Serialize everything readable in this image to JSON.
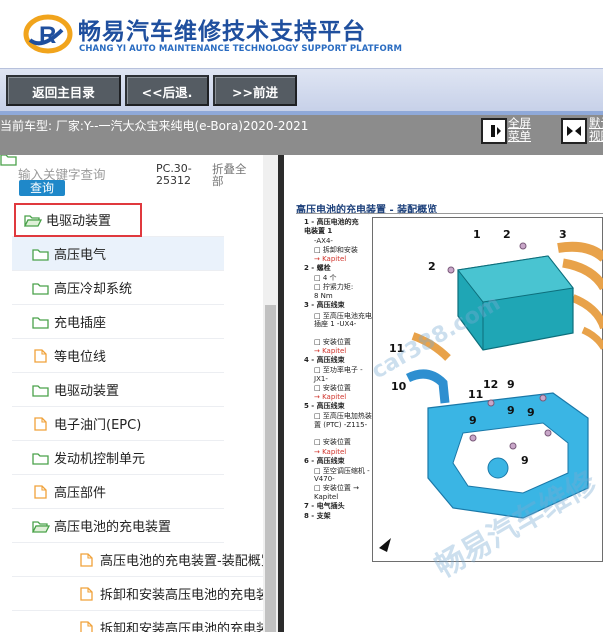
{
  "header": {
    "title_cn": "畅易汽车维修技术支持平台",
    "title_en": "CHANG YI AUTO MAINTENANCE TECHNOLOGY SUPPORT PLATFORM"
  },
  "nav": {
    "home": "返回主目录",
    "back": "<<后退.",
    "forward": ">>前进"
  },
  "carbar": {
    "current_car": "当前车型:  厂家:Y--一汽大众宝来纯电(e-Bora)2020-2021",
    "fullscreen_1": "全屏",
    "fullscreen_2": "菜单",
    "default_1": "默认",
    "default_2": "视图"
  },
  "left": {
    "search_placeholder": "输入关键字查询",
    "query_btn": "查询",
    "pc_label_1": "PC.30-",
    "pc_label_2": "25312",
    "collapse_1": "折叠全",
    "collapse_2": "部",
    "tree": [
      {
        "label": "电驱动装置",
        "icon": "folder-open-icon",
        "level": 1
      },
      {
        "label": "高压电气",
        "icon": "folder-icon",
        "level": 2
      },
      {
        "label": "高压冷却系统",
        "icon": "folder-icon",
        "level": 2
      },
      {
        "label": "充电插座",
        "icon": "folder-icon",
        "level": 2
      },
      {
        "label": "等电位线",
        "icon": "document-icon",
        "level": 2
      },
      {
        "label": "电驱动装置",
        "icon": "folder-icon",
        "level": 2
      },
      {
        "label": "电子油门(EPC)",
        "icon": "document-icon",
        "level": 2
      },
      {
        "label": "发动机控制单元",
        "icon": "folder-icon",
        "level": 2
      },
      {
        "label": "高压部件",
        "icon": "document-icon",
        "level": 2
      },
      {
        "label": "高压电池的充电装置",
        "icon": "folder-open-icon",
        "level": 2
      },
      {
        "label": "高压电池的充电装置-装配概览",
        "icon": "document-icon",
        "level": 3
      },
      {
        "label": "拆卸和安装高压电池的充电装置",
        "icon": "document-icon",
        "level": 3
      },
      {
        "label": "拆卸和安装高压电池的充电装置",
        "icon": "document-icon",
        "level": 3
      }
    ]
  },
  "doc": {
    "title": "高压电池的充电装置 - 装配概览",
    "watermark_1": "car388.com",
    "watermark_2": "畅易汽车维修",
    "legend": [
      {
        "n": "1 -",
        "t": "高压电池的充电装置 1",
        "b": true
      },
      {
        "n": "",
        "t": "-AX4-",
        "b": false
      },
      {
        "n": "",
        "t": "□ 拆卸和安装",
        "b": false
      },
      {
        "n": "",
        "t": "→ Kapitel",
        "r": true
      },
      {
        "n": "2 -",
        "t": "螺栓",
        "b": true
      },
      {
        "n": "",
        "t": "□ 4 个",
        "b": false
      },
      {
        "n": "",
        "t": "□ 拧紧力矩:",
        "b": false
      },
      {
        "n": "",
        "t": "8 Nm",
        "b": false
      },
      {
        "n": "3 -",
        "t": "高压线束",
        "b": true
      },
      {
        "n": "",
        "t": "□ 至高压电池充电插座 1 -UX4-",
        "b": false
      },
      {
        "n": "",
        "t": "□ 安装位置",
        "b": false
      },
      {
        "n": "",
        "t": "→ Kapitel",
        "r": true
      },
      {
        "n": "4 -",
        "t": "高压线束",
        "b": true
      },
      {
        "n": "",
        "t": "□ 至功率电子 -JX1-",
        "b": false
      },
      {
        "n": "",
        "t": "□ 安装位置",
        "b": false
      },
      {
        "n": "",
        "t": "→ Kapitel",
        "r": true
      },
      {
        "n": "5 -",
        "t": "高压线束",
        "b": true
      },
      {
        "n": "",
        "t": "□ 至高压电加热装置 (PTC) -Z115-",
        "b": false
      },
      {
        "n": "",
        "t": "□ 安装位置",
        "b": false
      },
      {
        "n": "",
        "t": "→ Kapitel",
        "r": true
      },
      {
        "n": "6 -",
        "t": "高压线束",
        "b": true
      },
      {
        "n": "",
        "t": "□ 至空调压缩机 -V470-",
        "b": false
      },
      {
        "n": "",
        "t": "□ 安装位置 → Kapitel",
        "b": false
      },
      {
        "n": "7 -",
        "t": "电气插头",
        "b": true
      },
      {
        "n": "8 -",
        "t": "支架",
        "b": true
      }
    ],
    "callouts": [
      "1",
      "2",
      "3",
      "2",
      "11",
      "10",
      "11",
      "12",
      "9",
      "9",
      "9",
      "9",
      "9"
    ]
  }
}
